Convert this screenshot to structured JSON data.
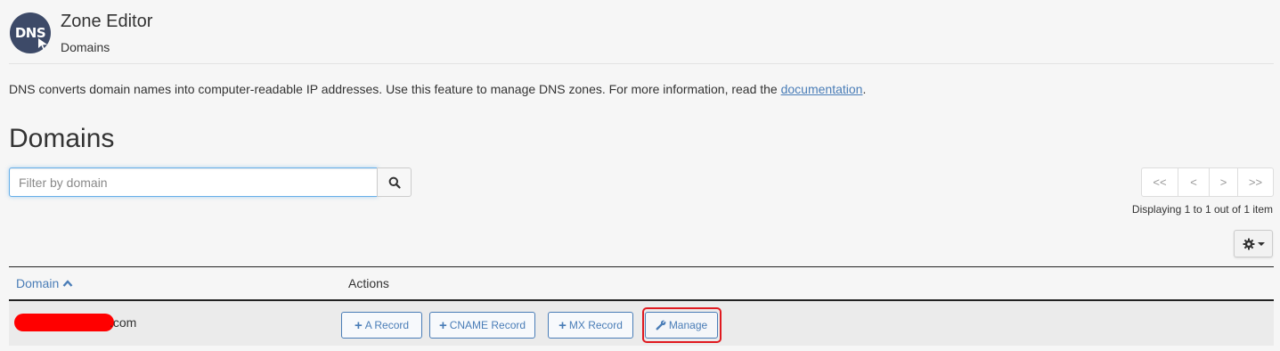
{
  "header": {
    "logo_text": "DNS",
    "title": "Zone Editor",
    "subtitle": "Domains"
  },
  "intro": {
    "text": "DNS converts domain names into computer-readable IP addresses. Use this feature to manage DNS zones. For more information, read the ",
    "link_text": "documentation",
    "suffix": "."
  },
  "section_title": "Domains",
  "search": {
    "placeholder": "Filter by domain",
    "value": "",
    "button_icon": "search-icon"
  },
  "pager": {
    "first": "<<",
    "prev": "<",
    "next": ">",
    "last": ">>",
    "info": "Displaying 1 to 1 out of 1 item"
  },
  "settings_icon": "gear-icon",
  "table": {
    "columns": {
      "domain": "Domain",
      "actions": "Actions"
    },
    "sort_icon": "chevron-up-icon",
    "rows": [
      {
        "domain_visible_suffix": ".com",
        "actions": {
          "a_record": "A Record",
          "cname_record": "CNAME Record",
          "mx_record": "MX Record",
          "manage": "Manage"
        }
      }
    ]
  },
  "colors": {
    "link": "#4a7db7",
    "highlight": "#e0191f",
    "redaction": "#ff0000",
    "logo_bg": "#3d4a68"
  }
}
